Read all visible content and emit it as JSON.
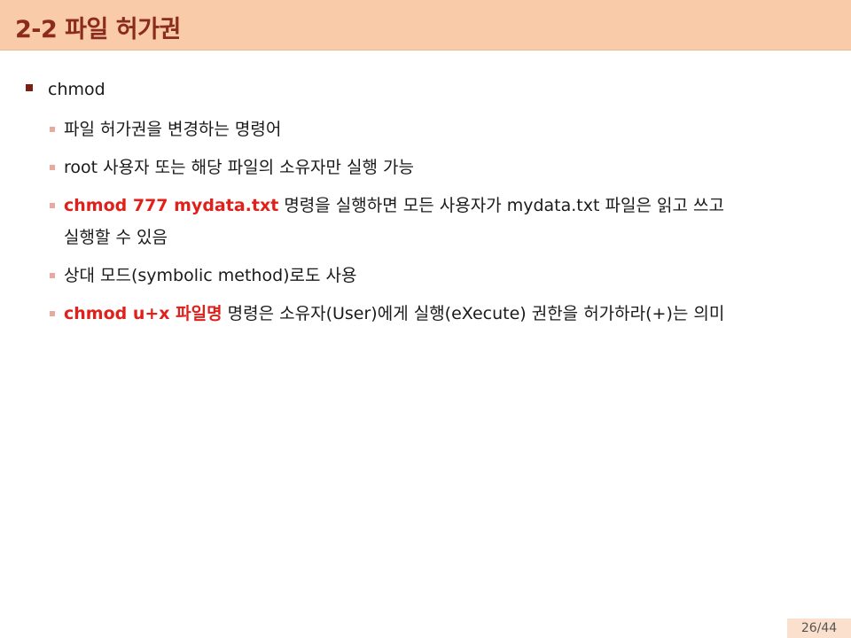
{
  "title": "2-2 파일 허가권",
  "bullet_main": "chmod",
  "items": [
    {
      "text": "파일 허가권을 변경하는 명령어"
    },
    {
      "text": "root 사용자 또는 해당 파일의 소유자만 실행 가능"
    },
    {
      "highlight": "chmod 777 mydata.txt",
      "text": " 명령을 실행하면 모든 사용자가 mydata.txt 파일은 읽고 쓰고",
      "continuation": "실행할 수 있음"
    },
    {
      "text": "상대 모드(symbolic method)로도 사용"
    },
    {
      "highlight": "chmod u+x 파일명",
      "text": " 명령은 소유자(User)에게 실행(eXecute) 권한을 허가하라(+)는 의미"
    }
  ],
  "page_number": "26/44",
  "colors": {
    "title_bar": "#f9cba9",
    "title_text": "#8b2b1e",
    "highlight_red": "#e0201a",
    "main_bullet": "#7a1f12",
    "sub_bullet": "#e9a9a0"
  }
}
